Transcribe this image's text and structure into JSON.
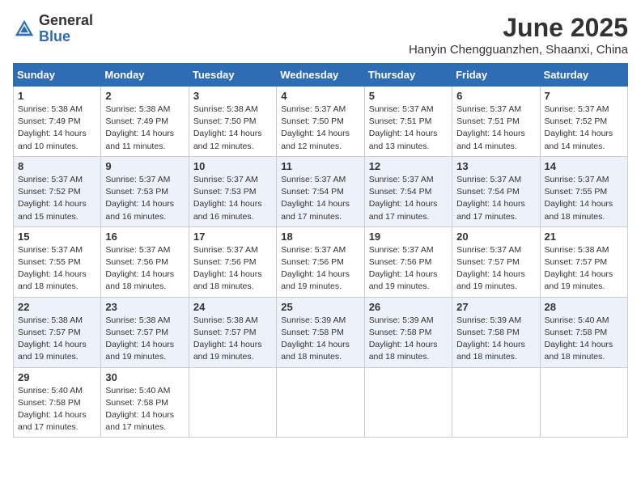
{
  "header": {
    "logo_general": "General",
    "logo_blue": "Blue",
    "title": "June 2025",
    "subtitle": "Hanyin Chengguanzhen, Shaanxi, China"
  },
  "days_of_week": [
    "Sunday",
    "Monday",
    "Tuesday",
    "Wednesday",
    "Thursday",
    "Friday",
    "Saturday"
  ],
  "weeks": [
    [
      {
        "day": "1",
        "sunrise": "Sunrise: 5:38 AM",
        "sunset": "Sunset: 7:49 PM",
        "daylight": "Daylight: 14 hours and 10 minutes."
      },
      {
        "day": "2",
        "sunrise": "Sunrise: 5:38 AM",
        "sunset": "Sunset: 7:49 PM",
        "daylight": "Daylight: 14 hours and 11 minutes."
      },
      {
        "day": "3",
        "sunrise": "Sunrise: 5:38 AM",
        "sunset": "Sunset: 7:50 PM",
        "daylight": "Daylight: 14 hours and 12 minutes."
      },
      {
        "day": "4",
        "sunrise": "Sunrise: 5:37 AM",
        "sunset": "Sunset: 7:50 PM",
        "daylight": "Daylight: 14 hours and 12 minutes."
      },
      {
        "day": "5",
        "sunrise": "Sunrise: 5:37 AM",
        "sunset": "Sunset: 7:51 PM",
        "daylight": "Daylight: 14 hours and 13 minutes."
      },
      {
        "day": "6",
        "sunrise": "Sunrise: 5:37 AM",
        "sunset": "Sunset: 7:51 PM",
        "daylight": "Daylight: 14 hours and 14 minutes."
      },
      {
        "day": "7",
        "sunrise": "Sunrise: 5:37 AM",
        "sunset": "Sunset: 7:52 PM",
        "daylight": "Daylight: 14 hours and 14 minutes."
      }
    ],
    [
      {
        "day": "8",
        "sunrise": "Sunrise: 5:37 AM",
        "sunset": "Sunset: 7:52 PM",
        "daylight": "Daylight: 14 hours and 15 minutes."
      },
      {
        "day": "9",
        "sunrise": "Sunrise: 5:37 AM",
        "sunset": "Sunset: 7:53 PM",
        "daylight": "Daylight: 14 hours and 16 minutes."
      },
      {
        "day": "10",
        "sunrise": "Sunrise: 5:37 AM",
        "sunset": "Sunset: 7:53 PM",
        "daylight": "Daylight: 14 hours and 16 minutes."
      },
      {
        "day": "11",
        "sunrise": "Sunrise: 5:37 AM",
        "sunset": "Sunset: 7:54 PM",
        "daylight": "Daylight: 14 hours and 17 minutes."
      },
      {
        "day": "12",
        "sunrise": "Sunrise: 5:37 AM",
        "sunset": "Sunset: 7:54 PM",
        "daylight": "Daylight: 14 hours and 17 minutes."
      },
      {
        "day": "13",
        "sunrise": "Sunrise: 5:37 AM",
        "sunset": "Sunset: 7:54 PM",
        "daylight": "Daylight: 14 hours and 17 minutes."
      },
      {
        "day": "14",
        "sunrise": "Sunrise: 5:37 AM",
        "sunset": "Sunset: 7:55 PM",
        "daylight": "Daylight: 14 hours and 18 minutes."
      }
    ],
    [
      {
        "day": "15",
        "sunrise": "Sunrise: 5:37 AM",
        "sunset": "Sunset: 7:55 PM",
        "daylight": "Daylight: 14 hours and 18 minutes."
      },
      {
        "day": "16",
        "sunrise": "Sunrise: 5:37 AM",
        "sunset": "Sunset: 7:56 PM",
        "daylight": "Daylight: 14 hours and 18 minutes."
      },
      {
        "day": "17",
        "sunrise": "Sunrise: 5:37 AM",
        "sunset": "Sunset: 7:56 PM",
        "daylight": "Daylight: 14 hours and 18 minutes."
      },
      {
        "day": "18",
        "sunrise": "Sunrise: 5:37 AM",
        "sunset": "Sunset: 7:56 PM",
        "daylight": "Daylight: 14 hours and 19 minutes."
      },
      {
        "day": "19",
        "sunrise": "Sunrise: 5:37 AM",
        "sunset": "Sunset: 7:56 PM",
        "daylight": "Daylight: 14 hours and 19 minutes."
      },
      {
        "day": "20",
        "sunrise": "Sunrise: 5:37 AM",
        "sunset": "Sunset: 7:57 PM",
        "daylight": "Daylight: 14 hours and 19 minutes."
      },
      {
        "day": "21",
        "sunrise": "Sunrise: 5:38 AM",
        "sunset": "Sunset: 7:57 PM",
        "daylight": "Daylight: 14 hours and 19 minutes."
      }
    ],
    [
      {
        "day": "22",
        "sunrise": "Sunrise: 5:38 AM",
        "sunset": "Sunset: 7:57 PM",
        "daylight": "Daylight: 14 hours and 19 minutes."
      },
      {
        "day": "23",
        "sunrise": "Sunrise: 5:38 AM",
        "sunset": "Sunset: 7:57 PM",
        "daylight": "Daylight: 14 hours and 19 minutes."
      },
      {
        "day": "24",
        "sunrise": "Sunrise: 5:38 AM",
        "sunset": "Sunset: 7:57 PM",
        "daylight": "Daylight: 14 hours and 19 minutes."
      },
      {
        "day": "25",
        "sunrise": "Sunrise: 5:39 AM",
        "sunset": "Sunset: 7:58 PM",
        "daylight": "Daylight: 14 hours and 18 minutes."
      },
      {
        "day": "26",
        "sunrise": "Sunrise: 5:39 AM",
        "sunset": "Sunset: 7:58 PM",
        "daylight": "Daylight: 14 hours and 18 minutes."
      },
      {
        "day": "27",
        "sunrise": "Sunrise: 5:39 AM",
        "sunset": "Sunset: 7:58 PM",
        "daylight": "Daylight: 14 hours and 18 minutes."
      },
      {
        "day": "28",
        "sunrise": "Sunrise: 5:40 AM",
        "sunset": "Sunset: 7:58 PM",
        "daylight": "Daylight: 14 hours and 18 minutes."
      }
    ],
    [
      {
        "day": "29",
        "sunrise": "Sunrise: 5:40 AM",
        "sunset": "Sunset: 7:58 PM",
        "daylight": "Daylight: 14 hours and 17 minutes."
      },
      {
        "day": "30",
        "sunrise": "Sunrise: 5:40 AM",
        "sunset": "Sunset: 7:58 PM",
        "daylight": "Daylight: 14 hours and 17 minutes."
      },
      null,
      null,
      null,
      null,
      null
    ]
  ]
}
